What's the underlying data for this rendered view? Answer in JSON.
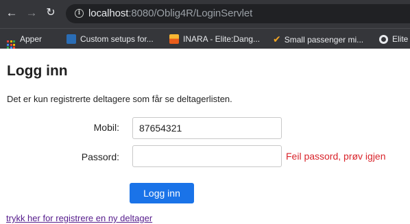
{
  "browser": {
    "url_host": "localhost",
    "url_rest": ":8080/Oblig4R/LoginServlet"
  },
  "bookmarks": [
    {
      "label": "Apper",
      "icon": "apps-grid-icon"
    },
    {
      "label": "Custom setups for...",
      "icon": "custom-setups-favicon"
    },
    {
      "label": "INARA - Elite:Dang...",
      "icon": "inara-favicon"
    },
    {
      "label": "Small passenger mi...",
      "icon": "v-favicon"
    },
    {
      "label": "Elite",
      "icon": "elite-favicon"
    }
  ],
  "page": {
    "heading": "Logg inn",
    "intro": "Det er kun registrerte deltagere som får se deltagerlisten.",
    "form": {
      "mobil_label": "Mobil:",
      "mobil_value": "87654321",
      "passord_label": "Passord:",
      "passord_value": "",
      "error_message": "Feil passord, prøv igjen",
      "submit_label": "Logg inn"
    },
    "register_link": "trykk her for registrere en ny deltager"
  },
  "colors": {
    "button": "#1a73e8",
    "error": "#d9232a",
    "link": "#551a8b",
    "chrome": "#35363a"
  }
}
